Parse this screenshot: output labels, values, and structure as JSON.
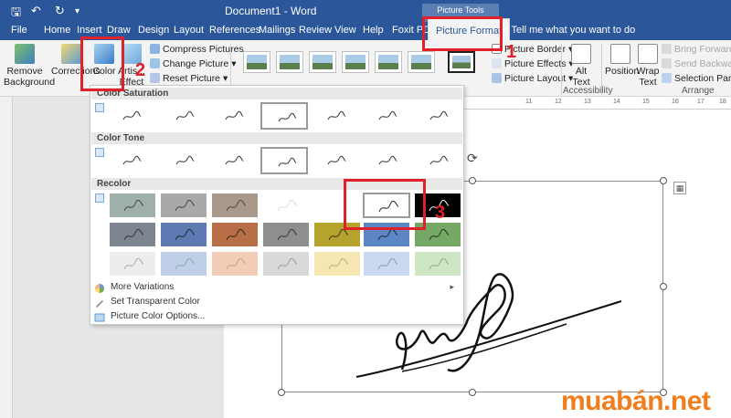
{
  "titlebar": {
    "doc_title": "Document1  -  Word",
    "context_tab_group": "Picture Tools"
  },
  "tabs": [
    "File",
    "Home",
    "Insert",
    "Draw",
    "Design",
    "Layout",
    "References",
    "Mailings",
    "Review",
    "View",
    "Help",
    "Foxit PDF",
    "Picture Format"
  ],
  "tell_me": "Tell me what you want to do",
  "ribbon": {
    "remove_background": "Remove Background",
    "corrections": "Corrections",
    "color": "Color",
    "artistic_effects": "Artis... Effect",
    "compress_pictures": "Compress Pictures",
    "change_picture": "Change Picture",
    "reset_picture": "Reset Picture",
    "picture_border": "Picture Border",
    "picture_effects": "Picture Effects",
    "picture_layout": "Picture Layout",
    "alt_text": "Alt Text",
    "accessibility": "Accessibility",
    "position": "Position",
    "wrap_text": "Wrap Text",
    "bring_forward": "Bring Forward",
    "send_backward": "Send Backward",
    "selection_pane": "Selection Pane",
    "arrange": "Arrange"
  },
  "dropdown": {
    "color_saturation": "Color Saturation",
    "color_tone": "Color Tone",
    "recolor": "Recolor",
    "more_variations": "More Variations",
    "set_transparent_color": "Set Transparent Color",
    "picture_color_options": "Picture Color Options..."
  },
  "recolor_colors": [
    [
      "#9fb0a8",
      "#a9a9a9",
      "#a9998a",
      "#ffffff",
      "#ffffff",
      "#000000"
    ],
    [
      "#7d8590",
      "#5d7ab2",
      "#b86f48",
      "#8f8f8f",
      "#b5a32e",
      "#5d86c5",
      "#74a864"
    ],
    [
      "#ededed",
      "#bfcfe8",
      "#f2cdb7",
      "#d9d9d9",
      "#f6e7b2",
      "#c9daf0",
      "#cfe6c5"
    ]
  ],
  "callouts": [
    "1",
    "2",
    "3"
  ],
  "ruler_ticks": [
    "11",
    "12",
    "13",
    "14",
    "15",
    "16",
    "17",
    "18"
  ],
  "watermark": {
    "text1": "muabán",
    "text2": ".net"
  },
  "accent": "#2b579a",
  "callout_color": "#e0212a"
}
